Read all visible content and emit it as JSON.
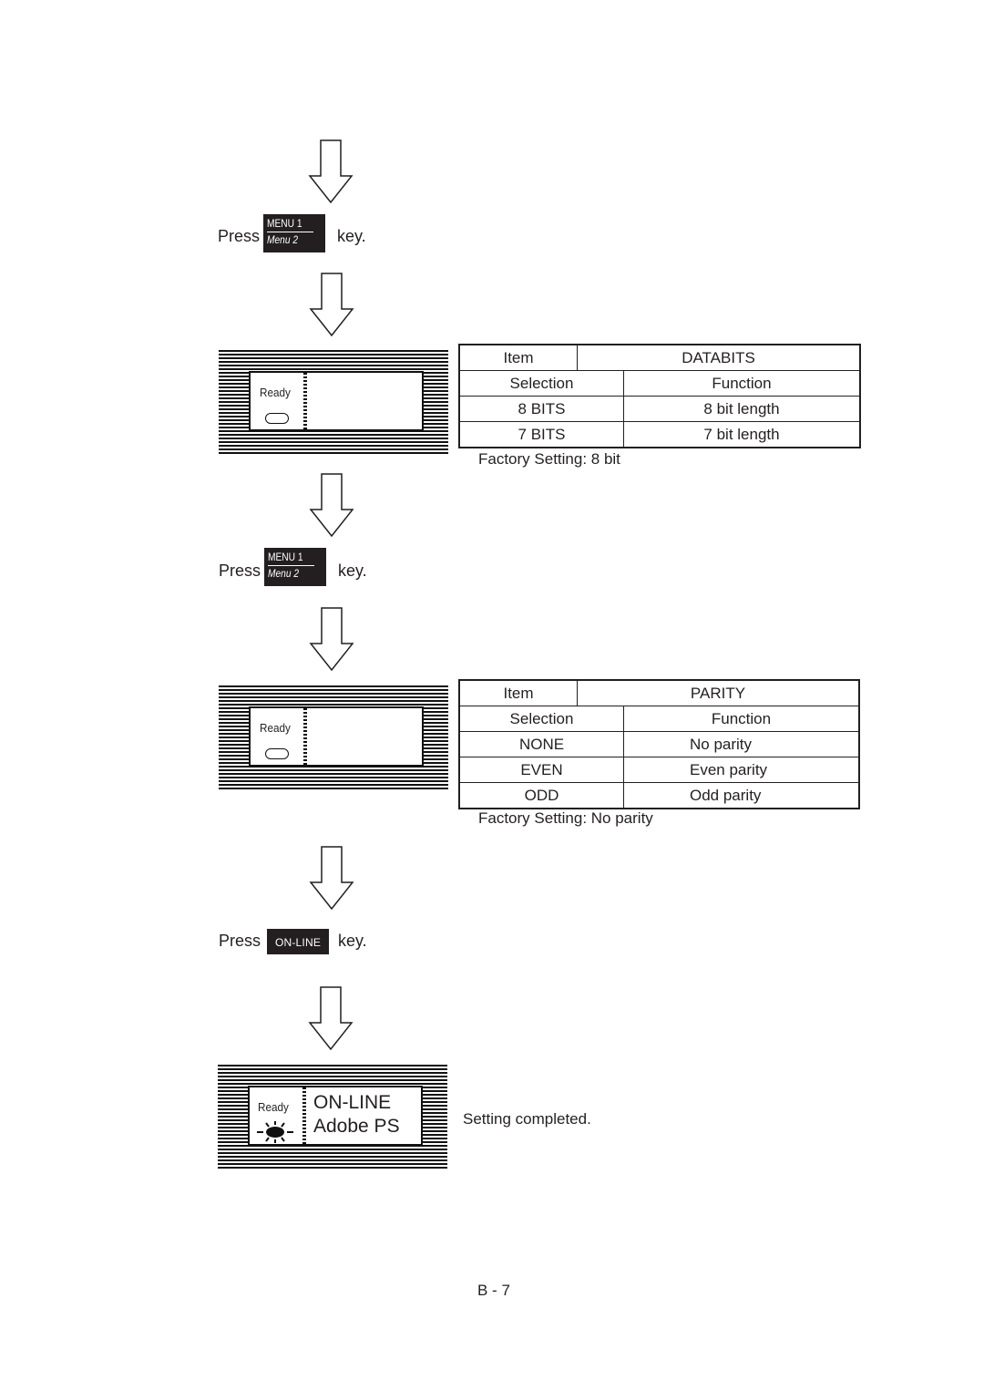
{
  "steps": {
    "press1": {
      "prefix": "Press",
      "key_top": "MENU 1",
      "key_bottom": "Menu 2",
      "suffix": "key."
    },
    "press2": {
      "prefix": "Press",
      "key_top": "MENU 1",
      "key_bottom": "Menu 2",
      "suffix": "key."
    },
    "press3": {
      "prefix": "Press",
      "key_label": "ON-LINE",
      "suffix": "key."
    }
  },
  "panels": {
    "panel1": {
      "ready_label": "Ready",
      "led_state": "off",
      "lcd_line1": "",
      "lcd_line2": ""
    },
    "panel2": {
      "ready_label": "Ready",
      "led_state": "off",
      "lcd_line1": "",
      "lcd_line2": ""
    },
    "panel3": {
      "ready_label": "Ready",
      "led_state": "on",
      "lcd_line1": "ON-LINE",
      "lcd_line2": "Adobe PS"
    }
  },
  "databits_table": {
    "item_label": "Item",
    "item_value": "DATABITS",
    "selection_header": "Selection",
    "function_header": "Function",
    "rows": [
      {
        "selection": "8 BITS",
        "function": "8 bit length"
      },
      {
        "selection": "7 BITS",
        "function": "7 bit length"
      }
    ],
    "factory_setting": "Factory Setting:  8 bit"
  },
  "parity_table": {
    "item_label": "Item",
    "item_value": "PARITY",
    "selection_header": "Selection",
    "function_header": "Function",
    "rows": [
      {
        "selection": "NONE",
        "function": "No parity"
      },
      {
        "selection": "EVEN",
        "function": "Even parity"
      },
      {
        "selection": "ODD",
        "function": "Odd parity"
      }
    ],
    "factory_setting": "Factory Setting:  No parity"
  },
  "completion_note": "Setting completed.",
  "page_number": "B - 7"
}
